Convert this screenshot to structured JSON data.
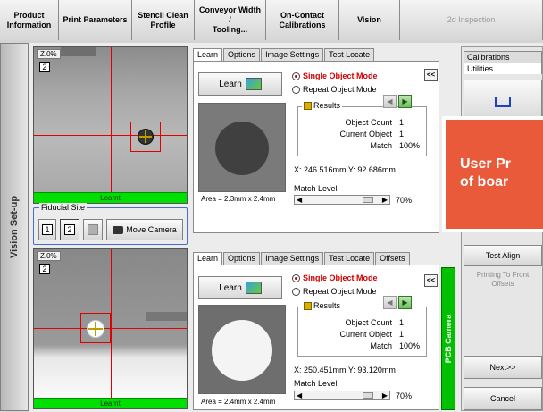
{
  "nav": {
    "items": [
      {
        "label": "Product\nInformation",
        "w": 66
      },
      {
        "label": "Print Parameters",
        "w": 82
      },
      {
        "label": "Stencil Clean\nProfile",
        "w": 70
      },
      {
        "label": "Conveyor Width /\nTooling...",
        "w": 80
      },
      {
        "label": "On-Contact\nCalibrations",
        "w": 82
      },
      {
        "label": "Vision",
        "w": 68
      },
      {
        "label": "2d Inspection",
        "w": 160
      }
    ]
  },
  "side_tab": "Vision Set-up",
  "camera1": {
    "zoom": "Z.0%",
    "index": "2",
    "status": "Learnt"
  },
  "camera2": {
    "zoom": "Z.0%",
    "index": "2",
    "status": "Learnt"
  },
  "fiducial_site": {
    "legend": "Fiducial Site",
    "site1": "1",
    "site2": "2",
    "move_camera": "Move Camera"
  },
  "panel1": {
    "tabs": [
      "Learn",
      "Options",
      "Image Settings",
      "Test Locate"
    ],
    "learn_label": "Learn",
    "mode_single": "Single Object Mode",
    "mode_repeat": "Repeat Object Mode",
    "results_label": "Results",
    "object_count_label": "Object Count",
    "object_count": "1",
    "current_object_label": "Current Object",
    "current_object": "1",
    "match_label": "Match",
    "match": "100%",
    "xy": "X: 246.516mm Y: 92.686mm",
    "match_level_label": "Match Level",
    "match_level": "70%",
    "area": "Area = 2.3mm x 2.4mm",
    "collapse": "<<"
  },
  "panel2": {
    "tabs": [
      "Learn",
      "Options",
      "Image Settings",
      "Test Locate",
      "Offsets"
    ],
    "learn_label": "Learn",
    "mode_single": "Single Object Mode",
    "mode_repeat": "Repeat Object Mode",
    "results_label": "Results",
    "object_count_label": "Object Count",
    "object_count": "1",
    "current_object_label": "Current Object",
    "current_object": "1",
    "match_label": "Match",
    "match": "100%",
    "xy": "X: 250.451mm Y: 93.120mm",
    "match_level_label": "Match Level",
    "match_level": "70%",
    "area": "Area = 2.4mm x 2.4mm",
    "collapse": "<<"
  },
  "pcb_camera": "PCB Camera",
  "right_panel": {
    "tab_calibrations": "Calibrations",
    "tab_utilities": "Utilities",
    "test_align": "Test Align",
    "printing_note": "Printing To Front\nOffsets",
    "next": "Next>>",
    "cancel": "Cancel"
  },
  "promo": {
    "text": "User Pr\nof boar"
  },
  "colors": {
    "learnt": "#00e000",
    "crosshair": "#e00000",
    "promo": "#e85a3a",
    "selected_mode": "#d00000"
  }
}
